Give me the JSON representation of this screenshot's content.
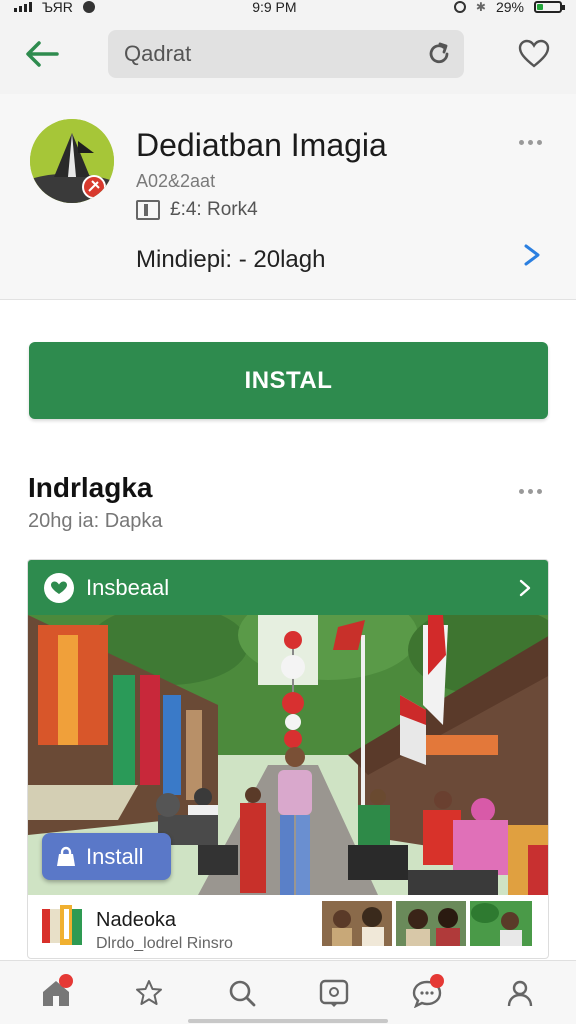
{
  "status_bar": {
    "carrier": "ЪЯR",
    "time": "9:9 PM",
    "battery": "29%",
    "battery_level": 0.29
  },
  "top_bar": {
    "search_text": "Qadrat"
  },
  "app": {
    "title": "Dediatban Imagia",
    "subtitle": "A02&2aat",
    "meta": "£:4: Rork4",
    "developer": "Mindiepi: - 20lagh"
  },
  "actions": {
    "install_main": "INSTAL"
  },
  "section": {
    "title": "Indrlagka",
    "subtitle": "20hg ia: Dapka"
  },
  "feature": {
    "header_label": "Insbeaal",
    "install_label": "Install",
    "footer_title": "Nadeoka",
    "footer_subtitle": "Dlrdo_lodrel Rinsro"
  },
  "colors": {
    "accent_green": "#2e8b4e",
    "overlay_blue": "#5a78c8",
    "link_blue": "#2b7fe0",
    "badge_red": "#e53935"
  },
  "bottom_nav": {
    "items": [
      "home-icon",
      "star-icon",
      "search-icon",
      "message-icon",
      "chat-icon",
      "profile-icon"
    ],
    "badges": [
      "",
      "",
      "",
      "",
      "",
      ""
    ]
  }
}
